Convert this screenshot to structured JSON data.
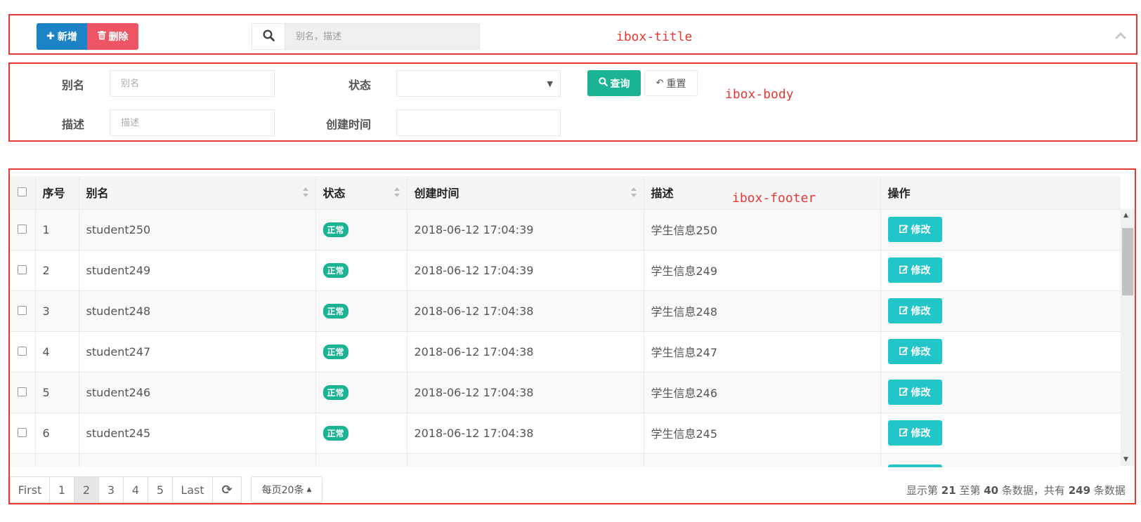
{
  "annotations": {
    "title_label": "ibox-title",
    "body_label": "ibox-body",
    "footer_label": "ibox-footer",
    "color": "#e53935"
  },
  "toolbar": {
    "add_label": "新增",
    "delete_label": "删除",
    "search_placeholder": "别名，描述"
  },
  "filters": {
    "alias_label": "别名",
    "alias_placeholder": "别名",
    "status_label": "状态",
    "desc_label": "描述",
    "desc_placeholder": "描述",
    "created_label": "创建时间",
    "query_label": "查询",
    "reset_label": "重置"
  },
  "table": {
    "headers": [
      "序号",
      "别名",
      "状态",
      "创建时间",
      "描述",
      "操作"
    ],
    "status_text": "正常",
    "edit_label": "修改",
    "rows": [
      {
        "no": "1",
        "alias": "student250",
        "created": "2018-06-12 17:04:39",
        "desc": "学生信息250"
      },
      {
        "no": "2",
        "alias": "student249",
        "created": "2018-06-12 17:04:39",
        "desc": "学生信息249"
      },
      {
        "no": "3",
        "alias": "student248",
        "created": "2018-06-12 17:04:38",
        "desc": "学生信息248"
      },
      {
        "no": "4",
        "alias": "student247",
        "created": "2018-06-12 17:04:38",
        "desc": "学生信息247"
      },
      {
        "no": "5",
        "alias": "student246",
        "created": "2018-06-12 17:04:38",
        "desc": "学生信息246"
      },
      {
        "no": "6",
        "alias": "student245",
        "created": "2018-06-12 17:04:38",
        "desc": "学生信息245"
      }
    ]
  },
  "pagination": {
    "first": "First",
    "pages": [
      "1",
      "2",
      "3",
      "4",
      "5"
    ],
    "active_page": "2",
    "last": "Last",
    "page_size": "每页20条",
    "info_prefix": "显示第",
    "from": "21",
    "info_mid1": "至第",
    "to": "40",
    "info_mid2": "条数据，共有",
    "total": "249",
    "info_suffix": "条数据"
  },
  "colors": {
    "primary": "#1ab394",
    "success_blue": "#1c84c6",
    "danger": "#ed5565",
    "info": "#23c6c8"
  }
}
